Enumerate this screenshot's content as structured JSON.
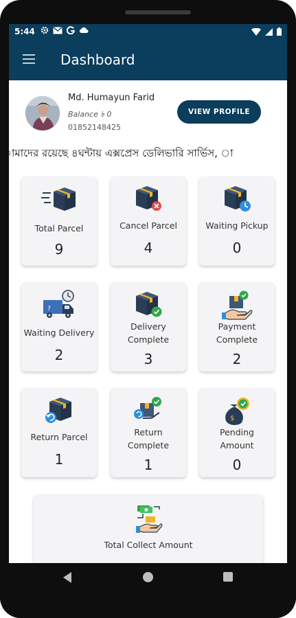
{
  "status": {
    "time": "5:44",
    "left_icons": [
      "gear-icon",
      "mail-icon",
      "google-icon",
      "cloud-icon"
    ],
    "right_icons": [
      "wifi-icon",
      "signal-icon",
      "battery-icon"
    ]
  },
  "appbar": {
    "title": "Dashboard"
  },
  "profile": {
    "name": "Md. Humayun Farid",
    "balance": "Balance ৳ 0",
    "phone": "01852148425",
    "view_button": "VIEW PROFILE"
  },
  "marquee": "ামাদের রয়েছে ৪ঘন্টায় এক্সপ্রেস ডেলিভারি সার্ভিস, া",
  "cards": [
    {
      "label": "Total Parcel",
      "value": "9",
      "icon": "fast-box-icon"
    },
    {
      "label": "Cancel Parcel",
      "value": "4",
      "icon": "box-cancel-icon"
    },
    {
      "label": "Waiting Pickup",
      "value": "0",
      "icon": "box-clock-icon"
    },
    {
      "label": "Waiting Delivery",
      "value": "2",
      "icon": "truck-clock-icon"
    },
    {
      "label": "Delivery Complete",
      "value": "3",
      "icon": "box-check-icon"
    },
    {
      "label": "Payment Complete",
      "value": "2",
      "icon": "hand-box-check-icon"
    },
    {
      "label": "Return Parcel",
      "value": "1",
      "icon": "box-return-icon"
    },
    {
      "label": "Return Complete",
      "value": "1",
      "icon": "box-return-check-icon"
    },
    {
      "label": "Pending Amount",
      "value": "0",
      "icon": "money-bag-icon"
    }
  ],
  "total_collect": {
    "label": "Total Collect Amount",
    "icon": "cash-hand-icon"
  },
  "colors": {
    "primary": "#0b3d5c",
    "card_bg": "#f4f4f6",
    "box": "#2a3d56",
    "check": "#2ea84a",
    "cancel": "#e04848",
    "clock": "#2f8fd8"
  }
}
